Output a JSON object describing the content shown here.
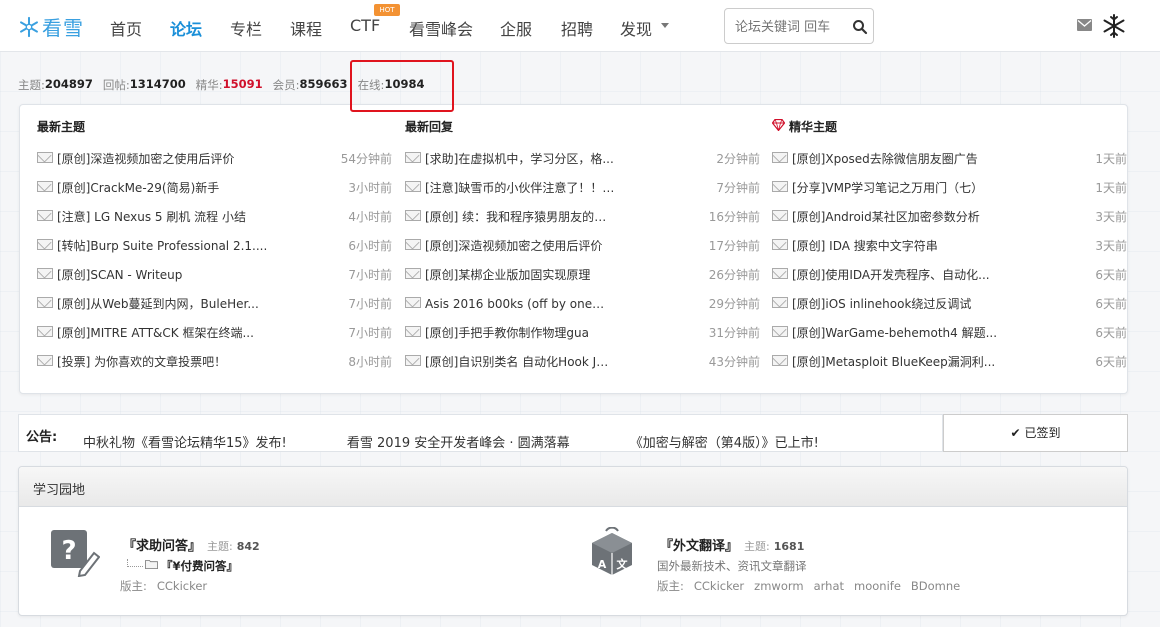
{
  "header": {
    "logo_text": "看雪",
    "nav": [
      "首页",
      "论坛",
      "专栏",
      "课程",
      "CTF",
      "看雪峰会",
      "企服",
      "招聘",
      "发现"
    ],
    "active_nav": "论坛",
    "hot_badge": "HOT",
    "search_placeholder": "论坛关键词 回车"
  },
  "stats": {
    "topics_label": "主题:",
    "topics": "204897",
    "replies_label": "回帖:",
    "replies": "1314700",
    "digest_label": "精华:",
    "digest": "15091",
    "members_label": "会员:",
    "members": "859663",
    "online_label": "在线:",
    "online": "10984"
  },
  "latest": {
    "columns": [
      {
        "title": "最新主题",
        "rows": [
          {
            "title": "[原创]深造视频加密之使用后评价",
            "time": "54分钟前"
          },
          {
            "title": "[原创]CrackMe-29(简易)新手",
            "time": "3小时前"
          },
          {
            "title": "[注意] LG Nexus 5 刷机 流程 小结",
            "time": "4小时前"
          },
          {
            "title": "[转帖]Burp Suite Professional 2.1....",
            "time": "6小时前"
          },
          {
            "title": "[原创]SCAN - Writeup",
            "time": "7小时前"
          },
          {
            "title": "[原创]从Web蔓延到内网，BuleHer...",
            "time": "7小时前"
          },
          {
            "title": "[原创]MITRE ATT&CK 框架在终端...",
            "time": "7小时前"
          },
          {
            "title": "[投票] 为你喜欢的文章投票吧！",
            "time": "8小时前"
          }
        ]
      },
      {
        "title": "最新回复",
        "rows": [
          {
            "title": "[求助]在虚拟机中，学习分区，格...",
            "time": "2分钟前"
          },
          {
            "title": "[注意]缺雪币的小伙伴注意了！！ ...",
            "time": "7分钟前"
          },
          {
            "title": "[原创] 续：我和程序猿男朋友的爱...",
            "time": "16分钟前"
          },
          {
            "title": "[原创]深造视频加密之使用后评价",
            "time": "17分钟前"
          },
          {
            "title": "[原创]某梆企业版加固实现原理",
            "time": "26分钟前"
          },
          {
            "title": "Asis 2016 b00ks (off by one利用)",
            "time": "29分钟前"
          },
          {
            "title": "[原创]手把手教你制作物理gua",
            "time": "31分钟前"
          },
          {
            "title": "[原创]自识别类名 自动化Hook Jus...",
            "time": "43分钟前"
          }
        ]
      },
      {
        "title": "精华主题",
        "rows": [
          {
            "title": "[原创]Xposed去除微信朋友圈广告",
            "time": "1天前"
          },
          {
            "title": "[分享]VMP学习笔记之万用门（七）",
            "time": "1天前"
          },
          {
            "title": "[原创]Android某社区加密参数分析",
            "time": "3天前"
          },
          {
            "title": "[原创] IDA 搜索中文字符串",
            "time": "3天前"
          },
          {
            "title": "[原创]使用IDA开发壳程序、自动化...",
            "time": "6天前"
          },
          {
            "title": "[原创]iOS inlinehook绕过反调试",
            "time": "6天前"
          },
          {
            "title": "[原创]WarGame-behemoth4 解题...",
            "time": "6天前"
          },
          {
            "title": "[原创]Metasploit BlueKeep漏洞利...",
            "time": "6天前"
          }
        ]
      }
    ]
  },
  "notice": {
    "label": "公告:",
    "items": [
      "中秋礼物《看雪论坛精华15》发布!",
      "看雪 2019 安全开发者峰会 · 圆满落幕",
      "《加密与解密（第4版）》已上市!"
    ],
    "signed_label": "已签到"
  },
  "study": {
    "title": "学习园地",
    "forums": [
      {
        "name": "『求助问答』",
        "count_label": "主题:",
        "count": "842",
        "subforum": "『¥付费问答』",
        "mods_label": "版主:",
        "mods": [
          "CCkicker"
        ]
      },
      {
        "name": "『外文翻译』",
        "count_label": "主题:",
        "count": "1681",
        "desc": "国外最新技术、资讯文章翻译",
        "mods_label": "版主:",
        "mods": [
          "CCkicker",
          "zmworm",
          "arhat",
          "moonife",
          "BDomne"
        ]
      }
    ]
  }
}
